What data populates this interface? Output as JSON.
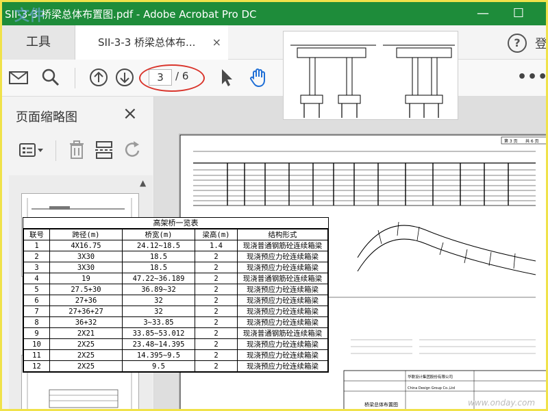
{
  "window": {
    "title": "SII-3-3 桥梁总体布置图.pdf - Adobe Acrobat Pro DC",
    "minimize": "—",
    "maximize": "☐",
    "watermark_logo": "文件"
  },
  "tabs": {
    "tools_label": "工具",
    "doc_label": "SII-3-3 桥梁总体布...",
    "close": "×"
  },
  "header": {
    "help": "?",
    "sign": "登"
  },
  "toolbar": {
    "current_page": "3",
    "total_pages": "/ 6",
    "more": "•••"
  },
  "sidebar": {
    "title": "页面缩略图",
    "close": "×"
  },
  "table": {
    "caption": "高架桥一览表",
    "headers": [
      "联号",
      "跨径(m)",
      "桥宽(m)",
      "梁高(m)",
      "结构形式"
    ],
    "rows": [
      [
        "1",
        "4X16.75",
        "24.12~18.5",
        "1.4",
        "现浇普通钢筋砼连续箱梁"
      ],
      [
        "2",
        "3X30",
        "18.5",
        "2",
        "现浇预应力砼连续箱梁"
      ],
      [
        "3",
        "3X30",
        "18.5",
        "2",
        "现浇预应力砼连续箱梁"
      ],
      [
        "4",
        "19",
        "47.22~36.189",
        "2",
        "现浇普通钢筋砼连续箱梁"
      ],
      [
        "5",
        "27.5+30",
        "36.89~32",
        "2",
        "现浇预应力砼连续箱梁"
      ],
      [
        "6",
        "27+36",
        "32",
        "2",
        "现浇预应力砼连续箱梁"
      ],
      [
        "7",
        "27+36+27",
        "32",
        "2",
        "现浇预应力砼连续箱梁"
      ],
      [
        "8",
        "36+32",
        "3~33.85",
        "2",
        "现浇预应力砼连续箱梁"
      ],
      [
        "9",
        "2X21",
        "33.85~53.012",
        "2",
        "现浇普通钢筋砼连续箱梁"
      ],
      [
        "10",
        "2X25",
        "23.48~14.395",
        "2",
        "现浇预应力砼连续箱梁"
      ],
      [
        "11",
        "2X25",
        "14.395~9.5",
        "2",
        "现浇预应力砼连续箱梁"
      ],
      [
        "12",
        "2X25",
        "9.5",
        "2",
        "现浇预应力砼连续箱梁"
      ]
    ]
  },
  "drawing": {
    "sheet_no": "第 3 页",
    "sheet_total": "共 6 页",
    "sheet_title": "桥梁总体布置图",
    "company_cn": "华联设计集团股份有限公司",
    "company_en": "China Design Group Co.,Ltd"
  },
  "footer": {
    "watermark": "www.onday.com"
  }
}
